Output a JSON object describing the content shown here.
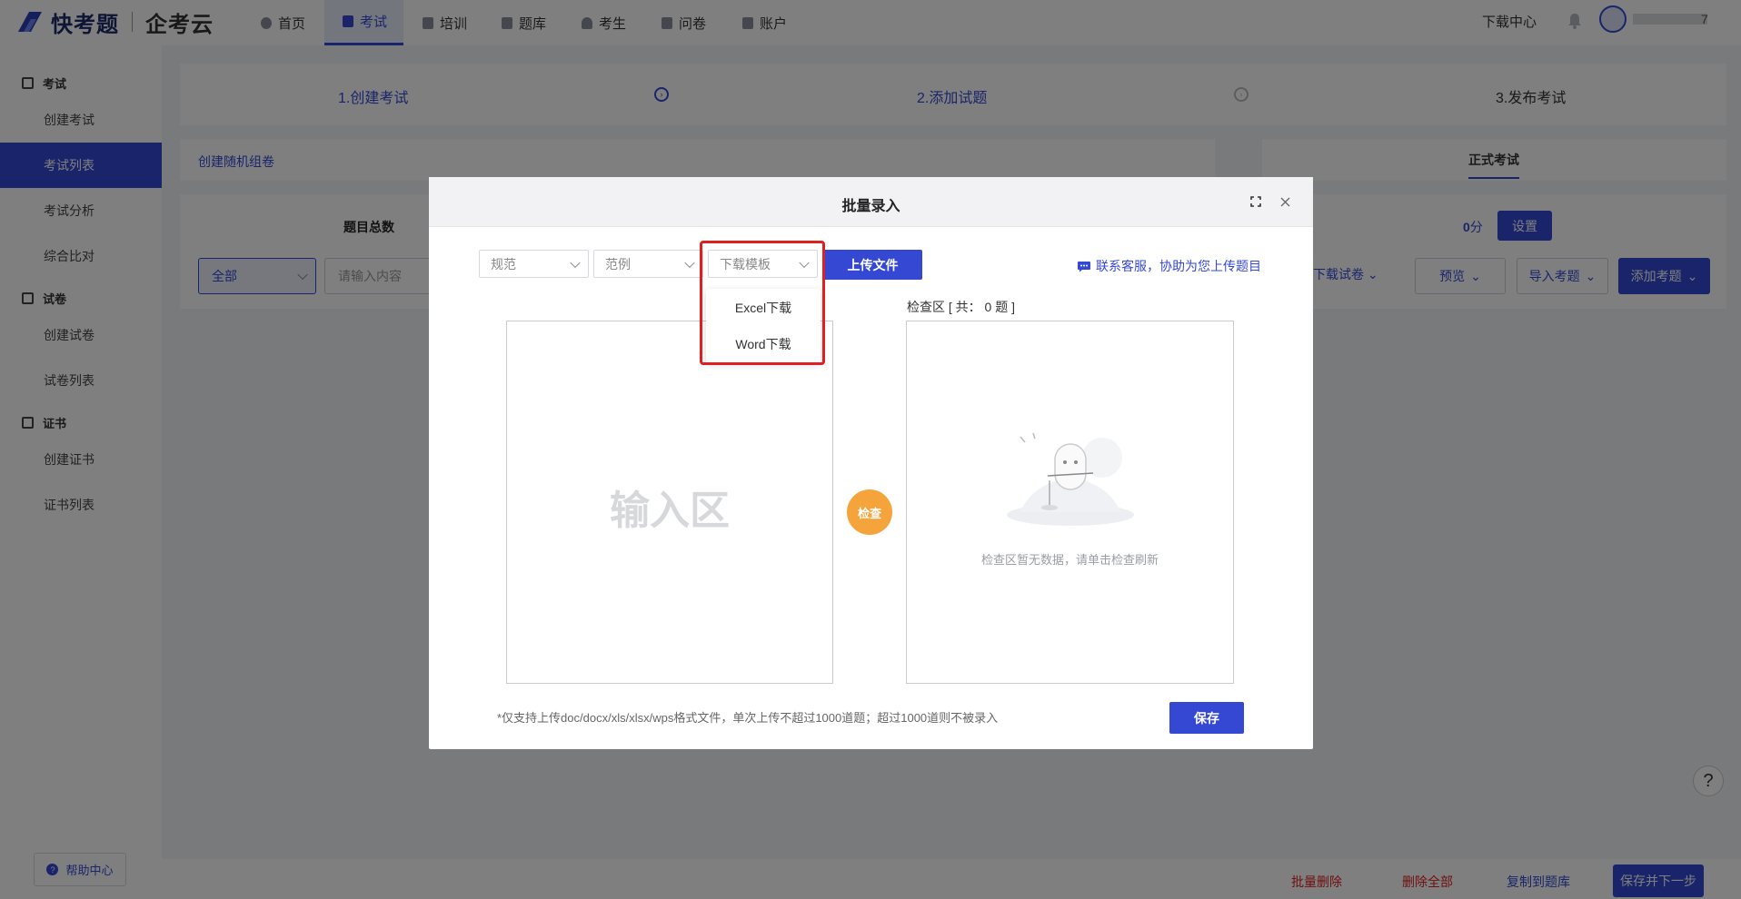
{
  "nav": {
    "logo_text_1": "快考题",
    "logo_text_2": "企考云",
    "items": [
      {
        "label": "首页"
      },
      {
        "label": "考试"
      },
      {
        "label": "培训"
      },
      {
        "label": "题库"
      },
      {
        "label": "考生"
      },
      {
        "label": "问卷"
      },
      {
        "label": "账户"
      }
    ],
    "download_center": "下载中心",
    "username_suffix": "7"
  },
  "sidebar": {
    "group_exam": "考试",
    "create_exam": "创建考试",
    "exam_list": "考试列表",
    "exam_analysis": "考试分析",
    "compare": "综合比对",
    "group_paper": "试卷",
    "create_paper": "创建试卷",
    "paper_list": "试卷列表",
    "group_cert": "证书",
    "create_cert": "创建证书",
    "cert_list": "证书列表",
    "help_center": "帮助中心"
  },
  "steps": {
    "step1": "1.创建考试",
    "step2": "2.添加试题",
    "step3": "3.发布考试"
  },
  "main": {
    "random_paper": "创建随机组卷",
    "formal_exam": "正式考试",
    "total_label": "题目总数",
    "score_value": "0",
    "score_unit": "分",
    "settings_btn": "设置",
    "filter_all": "全部",
    "search_placeholder": "请输入内容",
    "download_paper": "下载试卷",
    "preview": "预览",
    "import_questions": "导入考题",
    "add_questions": "添加考题"
  },
  "bottom": {
    "batch_delete": "批量删除",
    "delete_all": "删除全部",
    "copy_to_bank": "复制到题库",
    "save_next": "保存并下一步"
  },
  "modal": {
    "title": "批量录入",
    "sel_spec": "规范",
    "sel_example": "范例",
    "sel_template": "下载模板",
    "upload_btn": "上传文件",
    "contact": "联系客服，协助为您上传题目",
    "input_placeholder": "输入区",
    "check_btn": "检查",
    "check_area_label": "检查区 [ 共： 0 题 ]",
    "empty_text": "检查区暂无数据，请单击检查刷新",
    "footer_note": "*仅支持上传doc/docx/xls/xlsx/wps格式文件，单次上传不超过1000道题；超过1000道则不被录入",
    "save_btn": "保存",
    "dropdown": [
      {
        "label": "Excel下载"
      },
      {
        "label": "Word下载"
      }
    ]
  },
  "colors": {
    "primary": "#3548d4",
    "orange": "#f5a33b",
    "danger": "#e02020",
    "overlay": "rgba(0,0,0,0.5)"
  },
  "icons": {
    "fullscreen": "fullscreen-icon",
    "close": "close-icon",
    "bell": "bell-icon",
    "chat": "chat-icon",
    "question": "question-icon"
  }
}
